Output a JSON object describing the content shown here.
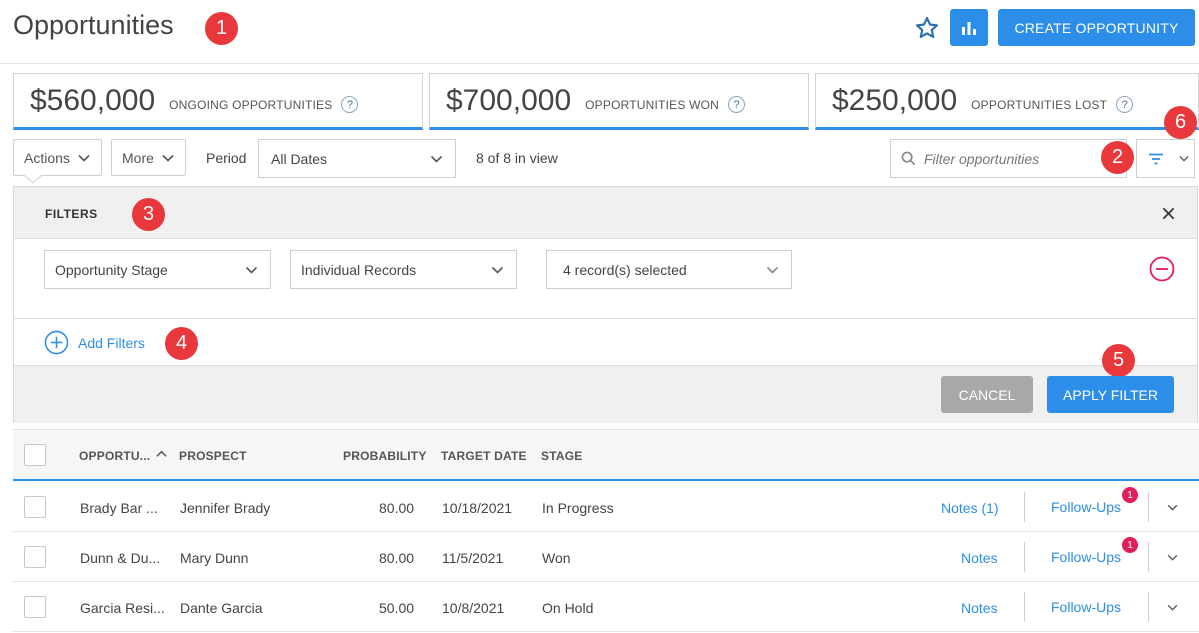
{
  "header": {
    "title": "Opportunities",
    "create_label": "CREATE OPPORTUNITY"
  },
  "stats": [
    {
      "amount": "$560,000",
      "label": "ONGOING OPPORTUNITIES"
    },
    {
      "amount": "$700,000",
      "label": "OPPORTUNITIES WON"
    },
    {
      "amount": "$250,000",
      "label": "OPPORTUNITIES LOST"
    }
  ],
  "toolbar": {
    "actions_label": "Actions",
    "more_label": "More",
    "period_label": "Period",
    "period_value": "All Dates",
    "view_count": "8 of 8 in view",
    "search_placeholder": "Filter opportunities"
  },
  "filters": {
    "title": "FILTERS",
    "field": "Opportunity Stage",
    "mode": "Individual Records",
    "selection": "4 record(s) selected",
    "add_label": "Add Filters",
    "cancel_label": "CANCEL",
    "apply_label": "APPLY FILTER"
  },
  "callouts": [
    "1",
    "2",
    "3",
    "4",
    "5",
    "6"
  ],
  "table": {
    "columns": [
      "OPPORTU...",
      "PROSPECT",
      "PROBABILITY",
      "TARGET DATE",
      "STAGE"
    ],
    "rows": [
      {
        "opportunity": "Brady Bar ...",
        "prospect": "Jennifer Brady",
        "probability": "80.00",
        "target_date": "10/18/2021",
        "stage": "In Progress",
        "notes": "Notes (1)",
        "followups": "Follow-Ups",
        "followup_badge": "1"
      },
      {
        "opportunity": "Dunn & Du...",
        "prospect": "Mary Dunn",
        "probability": "80.00",
        "target_date": "11/5/2021",
        "stage": "Won",
        "notes": "Notes",
        "followups": "Follow-Ups",
        "followup_badge": "1"
      },
      {
        "opportunity": "Garcia Resi...",
        "prospect": "Dante Garcia",
        "probability": "50.00",
        "target_date": "10/8/2021",
        "stage": "On Hold",
        "notes": "Notes",
        "followups": "Follow-Ups",
        "followup_badge": ""
      }
    ]
  },
  "colors": {
    "accent": "#2c8ee8",
    "callout": "#e8383b",
    "danger": "#e11d5a",
    "cancel": "#a8a8a8"
  },
  "icons": [
    "star-icon",
    "bar-chart-icon",
    "help-icon",
    "chevron-down-icon",
    "search-icon",
    "filter-icon",
    "close-icon",
    "minus-circle-icon",
    "plus-circle-icon",
    "sort-up-icon"
  ]
}
